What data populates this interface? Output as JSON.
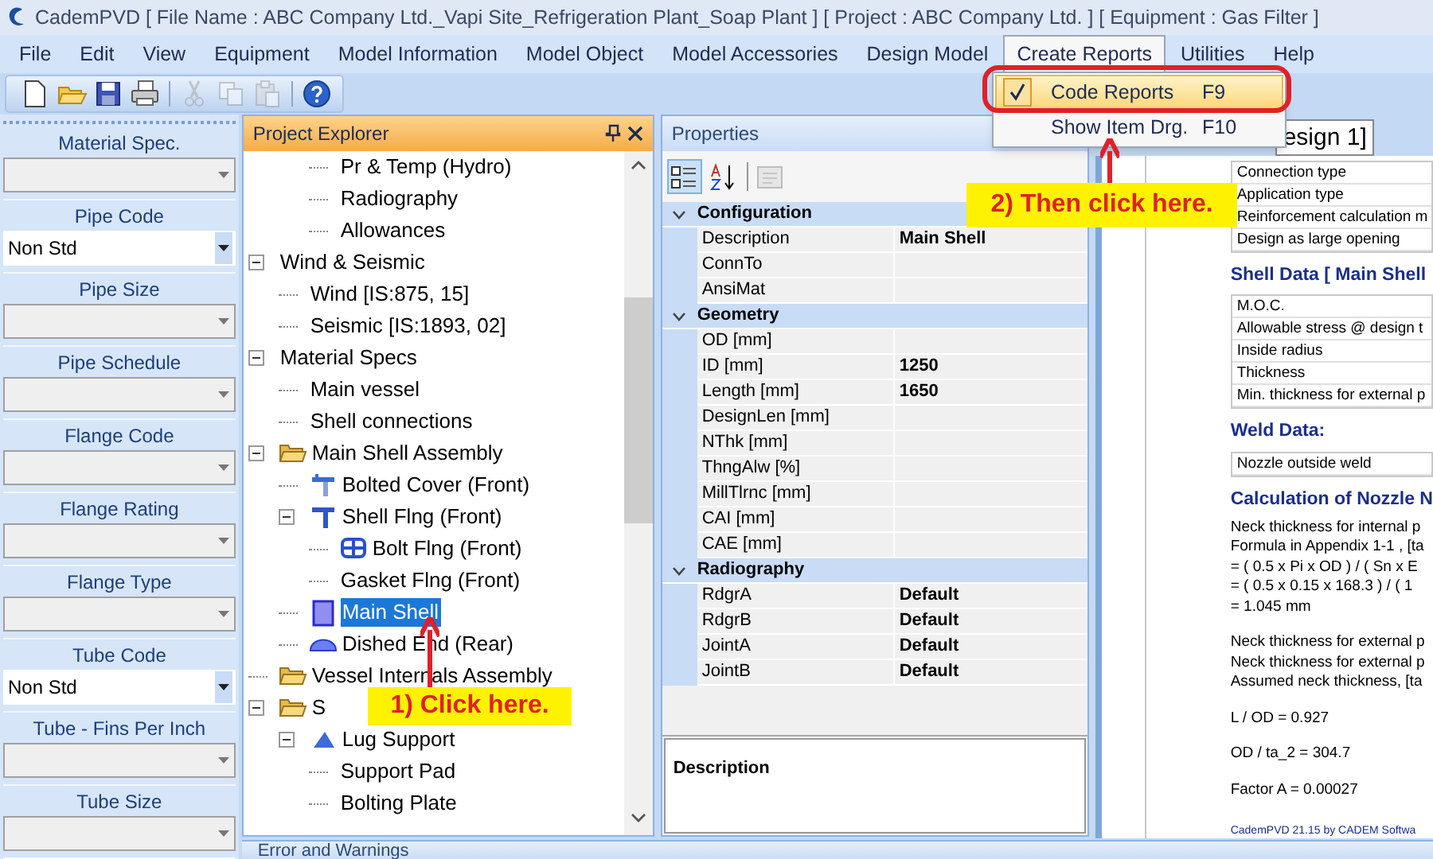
{
  "window": {
    "title": "CademPVD [ File Name : ABC Company Ltd._Vapi Site_Refrigeration Plant_Soap Plant ] [ Project : ABC Company Ltd. ] [ Equipment : Gas Filter ]"
  },
  "menu": [
    {
      "label": "File",
      "selected": false
    },
    {
      "label": "Edit",
      "selected": false
    },
    {
      "label": "View",
      "selected": false
    },
    {
      "label": "Equipment",
      "selected": false
    },
    {
      "label": "Model Information",
      "selected": false
    },
    {
      "label": "Model Object",
      "selected": false
    },
    {
      "label": "Model Accessories",
      "selected": false
    },
    {
      "label": "Design Model",
      "selected": false
    },
    {
      "label": "Create Reports",
      "selected": true
    },
    {
      "label": "Utilities",
      "selected": false
    },
    {
      "label": "Help",
      "selected": false
    }
  ],
  "open_menu": {
    "items": [
      {
        "label": "Code Reports",
        "shortcut": "F9",
        "checked": true,
        "selected": true
      },
      {
        "label": "Show Item Drg.",
        "shortcut": "F10",
        "checked": false,
        "selected": false
      }
    ]
  },
  "toolbar": [
    {
      "kind": "new",
      "disabled": false
    },
    {
      "kind": "open",
      "disabled": false
    },
    {
      "kind": "save",
      "disabled": false
    },
    {
      "kind": "print",
      "disabled": false
    },
    {
      "kind": "separator"
    },
    {
      "kind": "cut",
      "disabled": true
    },
    {
      "kind": "copy",
      "disabled": true
    },
    {
      "kind": "paste",
      "disabled": true
    },
    {
      "kind": "separator"
    },
    {
      "kind": "help",
      "disabled": false
    }
  ],
  "fields": [
    {
      "label": "Material Spec.",
      "disabled": true
    },
    {
      "label": "Pipe Code",
      "value": "Non Std",
      "disabled": false
    },
    {
      "label": "Pipe Size",
      "disabled": true
    },
    {
      "label": "Pipe Schedule",
      "disabled": true
    },
    {
      "label": "Flange Code",
      "disabled": true
    },
    {
      "label": "Flange Rating",
      "disabled": true
    },
    {
      "label": "Flange Type",
      "disabled": true
    },
    {
      "label": "Tube Code",
      "value": "Non Std",
      "disabled": false
    },
    {
      "label": "Tube - Fins Per Inch",
      "disabled": true
    },
    {
      "label": "Tube Size",
      "disabled": true
    }
  ],
  "explorer": {
    "title": "Project Explorer",
    "tree": [
      {
        "children": [
          {
            "children": [
              {
                "label": "Pr & Temp (Hydro)",
                "selected": false
              },
              {
                "label": "Radiography",
                "selected": false
              },
              {
                "label": "Allowances",
                "selected": false
              }
            ]
          }
        ]
      },
      {
        "label": "Wind & Seismic",
        "selected": false,
        "expanded": true,
        "children": [
          {
            "label": "Wind [IS:875, 15]",
            "selected": false
          },
          {
            "label": "Seismic [IS:1893, 02]",
            "selected": false
          }
        ]
      },
      {
        "label": "Material Specs",
        "selected": false,
        "expanded": true,
        "children": [
          {
            "label": "Main vessel",
            "selected": false
          },
          {
            "label": "Shell connections",
            "selected": false
          }
        ]
      },
      {
        "label": "Main Shell Assembly",
        "kind": "folder",
        "selected": false,
        "expanded": true,
        "children": [
          {
            "label": "Bolted Cover (Front)",
            "kind": "cover",
            "selected": false
          },
          {
            "label": "Shell Flng (Front)",
            "kind": "flange",
            "selected": false,
            "expanded": true,
            "children": [
              {
                "label": "Bolt Flng (Front)",
                "kind": "bolts",
                "selected": false
              },
              {
                "label": "Gasket Flng (Front)",
                "selected": false
              }
            ]
          },
          {
            "label": "Main Shell",
            "kind": "shell",
            "selected": true
          },
          {
            "label": "Dished End (Rear)",
            "kind": "dish",
            "selected": false
          }
        ]
      },
      {
        "label": "Vessel Internals Assembly",
        "kind": "folder",
        "selected": false
      },
      {
        "label": "S",
        "kind": "folder",
        "selected": false,
        "expanded": true,
        "children": [
          {
            "label": "Lug Support",
            "kind": "lug",
            "selected": false,
            "expanded": true,
            "children": [
              {
                "label": "Support Pad",
                "selected": false
              },
              {
                "label": "Bolting Plate",
                "selected": false
              }
            ]
          }
        ]
      }
    ]
  },
  "properties": {
    "title": "Properties",
    "toolbar": [
      {
        "kind": "categorized",
        "pressed": true,
        "disabled": false
      },
      {
        "kind": "alphabetical",
        "pressed": false,
        "disabled": false
      },
      {
        "kind": "pages",
        "pressed": false,
        "disabled": true
      }
    ],
    "categories": [
      {
        "name": "Configuration",
        "expanded": true,
        "rows": [
          {
            "name": "Description",
            "value": "Main Shell"
          },
          {
            "name": "ConnTo"
          },
          {
            "name": "AnsiMat"
          }
        ]
      },
      {
        "name": "Geometry",
        "expanded": true,
        "rows": [
          {
            "name": "OD [mm]"
          },
          {
            "name": "ID [mm]",
            "value": "1250"
          },
          {
            "name": "Length [mm]",
            "value": "1650"
          },
          {
            "name": "DesignLen [mm]"
          },
          {
            "name": "NThk [mm]"
          },
          {
            "name": "ThngAlw [%]"
          },
          {
            "name": "MillTlrnc [mm]"
          },
          {
            "name": "CAI [mm]"
          },
          {
            "name": "CAE [mm]"
          }
        ]
      },
      {
        "name": "Radiography",
        "expanded": true,
        "rows": [
          {
            "name": "RdgrA",
            "value": "Default"
          },
          {
            "name": "RdgrB",
            "value": "Default"
          },
          {
            "name": "JointA",
            "value": "Default"
          },
          {
            "name": "JointB",
            "value": "Default"
          }
        ]
      }
    ],
    "description_title": "Description"
  },
  "report": {
    "tab": "esign 1]",
    "blocks": [
      {
        "kind": "table",
        "rows": [
          "Connection type",
          "Application type",
          "Reinforcement calculation m",
          "Design as large opening"
        ]
      },
      {
        "kind": "heading",
        "text": "Shell Data [ Main Shell"
      },
      {
        "kind": "table",
        "rows": [
          "M.O.C.",
          "Allowable stress @ design t",
          "Inside radius",
          "Thickness",
          "Min. thickness for external p"
        ]
      },
      {
        "kind": "heading",
        "text": "Weld Data:"
      },
      {
        "kind": "table",
        "rows": [
          "Nozzle outside weld"
        ]
      },
      {
        "kind": "heading",
        "text": "Calculation of Nozzle N"
      },
      {
        "kind": "text",
        "lines": [
          "Neck thickness for internal p",
          "Formula in Appendix 1-1 , [ta",
          "= ( 0.5 x Pi x OD ) / ( Sn x E",
          "= ( 0.5 x 0.15 x 168.3 ) / ( 1",
          "= 1.045 mm"
        ]
      },
      {
        "kind": "text",
        "lines": [
          "Neck thickness for external p",
          "Neck thickness for external p",
          "Assumed neck thickness, [ta"
        ]
      },
      {
        "kind": "text",
        "lines": [
          "L / OD = 0.927"
        ]
      },
      {
        "kind": "text",
        "lines": [
          "OD / ta_2 = 304.7"
        ]
      },
      {
        "kind": "text",
        "lines": [
          "Factor A = 0.00027"
        ]
      },
      {
        "kind": "footer",
        "text": "CademPVD 21.15 by CADEM Softwa"
      }
    ]
  },
  "errors_panel": {
    "title": "Error and Warnings"
  },
  "annotations": [
    {
      "text": "1) Click here."
    },
    {
      "text": "2) Then click here."
    }
  ]
}
